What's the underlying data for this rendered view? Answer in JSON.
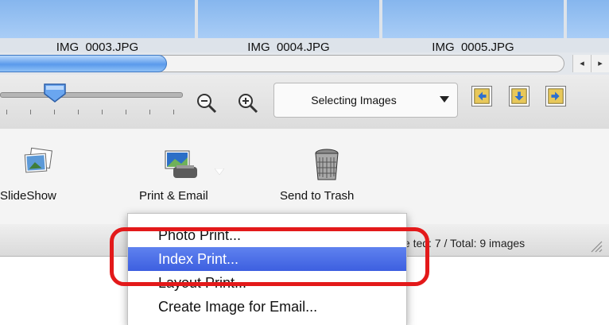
{
  "thumbnails": [
    {
      "filename": "IMG_0003.JPG"
    },
    {
      "filename": "IMG_0004.JPG"
    },
    {
      "filename": "IMG_0005.JPG"
    }
  ],
  "scroll_arrows": {
    "left": "◂",
    "right": "▸"
  },
  "mode_select": {
    "value": "Selecting Images"
  },
  "tasks": {
    "slideshow": {
      "label": "SlideShow"
    },
    "print_email": {
      "label": "Print & Email"
    },
    "trash": {
      "label": "Send to Trash"
    }
  },
  "status": {
    "text": "ele  ted: 7 / Total: 9 images"
  },
  "menu": {
    "items": [
      {
        "label": "Photo Print..."
      },
      {
        "label": "Index Print...",
        "selected": true
      },
      {
        "label": "Layout Print..."
      },
      {
        "label": "Create Image for Email..."
      }
    ]
  },
  "colors": {
    "highlight": "#3d5fe0",
    "annotation": "#e3191a",
    "thumb": "#9ec6f4"
  }
}
